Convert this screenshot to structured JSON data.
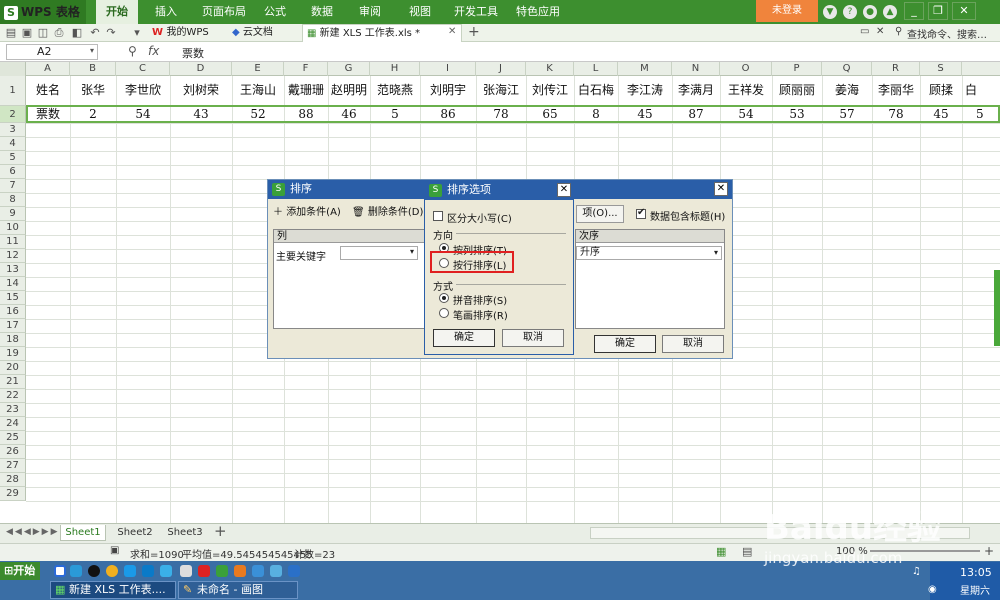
{
  "app": {
    "logo": "WPS 表格",
    "menu_tabs": [
      "开始",
      "插入",
      "页面布局",
      "公式",
      "数据",
      "审阅",
      "视图",
      "开发工具",
      "特色应用"
    ],
    "login": "未登录"
  },
  "doc_tabs": [
    {
      "label": "我的WPS"
    },
    {
      "label": "云文档"
    },
    {
      "label": "新建 XLS 工作表.xls *"
    }
  ],
  "search_placeholder": "查找命令、搜索…",
  "formula_bar": {
    "name_box": "A2",
    "fx": "fx",
    "content": "票数"
  },
  "columns": [
    "A",
    "B",
    "C",
    "D",
    "E",
    "F",
    "G",
    "H",
    "I",
    "J",
    "K",
    "L",
    "M",
    "N",
    "O",
    "P",
    "Q",
    "R",
    "S"
  ],
  "row_numbers": [
    "1",
    "2",
    "3",
    "4",
    "5",
    "6",
    "7",
    "8",
    "9",
    "10",
    "11",
    "12",
    "13",
    "14",
    "15",
    "16",
    "17",
    "18",
    "19",
    "20",
    "21",
    "22",
    "23",
    "24",
    "25",
    "26",
    "27",
    "28",
    "29"
  ],
  "row1": [
    "姓名",
    "张华",
    "李世欣",
    "刘树荣",
    "王海山",
    "戴珊珊",
    "赵明明",
    "范晓燕",
    "刘明宇",
    "张海江",
    "刘传江",
    "白石梅",
    "李江涛",
    "李满月",
    "王祥发",
    "顾丽丽",
    "姜海",
    "李丽华",
    "顾揉",
    "白"
  ],
  "row2": [
    "票数",
    "2",
    "54",
    "43",
    "52",
    "88",
    "46",
    "5",
    "86",
    "78",
    "65",
    "8",
    "45",
    "87",
    "54",
    "53",
    "57",
    "78",
    "45",
    "5"
  ],
  "sort_dialog": {
    "title": "排序",
    "add_condition": "添加条件(A)",
    "delete_condition": "删除条件(D)",
    "options_button": "项(O)...",
    "has_header": "数据包含标题(H)",
    "col_header": "列",
    "primary_key": "主要关键字",
    "order_header": "次序",
    "order_value": "升序",
    "ok": "确定",
    "cancel": "取消"
  },
  "options_dialog": {
    "title": "排序选项",
    "case_sensitive": "区分大小写(C)",
    "direction_label": "方向",
    "by_column": "按列排序(T)",
    "by_row": "按行排序(L)",
    "method_label": "方式",
    "pinyin": "拼音排序(S)",
    "stroke": "笔画排序(R)",
    "ok": "确定",
    "cancel": "取消"
  },
  "sheets": [
    "Sheet1",
    "Sheet2",
    "Sheet3"
  ],
  "status": {
    "sum": "求和=1090",
    "avg": "平均值=49.545454545455",
    "count": "计数=23",
    "zoom": "100 %"
  },
  "taskbar": {
    "start": "开始",
    "tasks": [
      "新建 XLS 工作表....",
      "未命名 - 画图"
    ],
    "time": "13:05",
    "weekday": "星期六"
  },
  "watermark": {
    "brand": "Baidu经验",
    "url": "jingyan.baidu.com"
  },
  "colors": {
    "accent": "#3d8f2f",
    "highlight_box": "#e02020",
    "dialog_title": "#2a5ea8"
  }
}
